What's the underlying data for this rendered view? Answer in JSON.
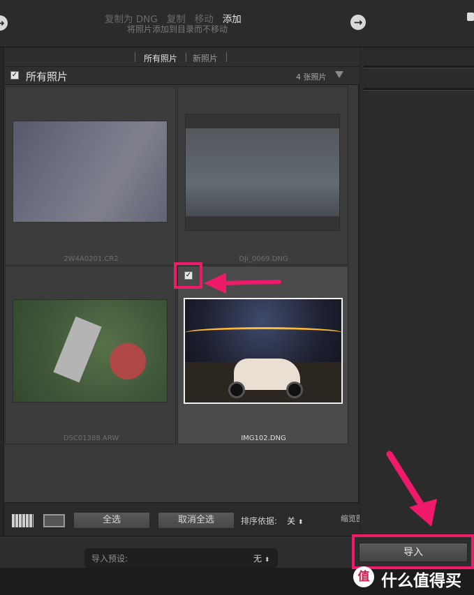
{
  "topbar": {
    "modes": [
      "复制为 DNG",
      "复制",
      "移动",
      "添加"
    ],
    "active_mode": "添加",
    "mode_description": "将照片添加到目录而不移动",
    "nav_arrow": "→"
  },
  "grid": {
    "tabs": [
      "所有照片",
      "新照片"
    ],
    "title": "所有照片",
    "count": "4 张照片",
    "photos": [
      {
        "filename": "2W4A0201.CR2",
        "checked": false
      },
      {
        "filename": "DJI_0069.DNG",
        "checked": false
      },
      {
        "filename": "DSC01388.ARW",
        "checked": false
      },
      {
        "filename": "IMG102.DNG",
        "checked": true
      }
    ]
  },
  "footer": {
    "select_all": "全选",
    "deselect_all": "取消全选",
    "sort_label": "排序依据:",
    "sort_value": "关",
    "thumb_size_label": "缩览图"
  },
  "bottom": {
    "preset_label": "导入预设:",
    "preset_value": "无",
    "import_button": "导入"
  },
  "watermark": {
    "badge": "值",
    "text": "什么值得买"
  },
  "colors": {
    "highlight": "#f01a6a",
    "background": "#262626"
  }
}
